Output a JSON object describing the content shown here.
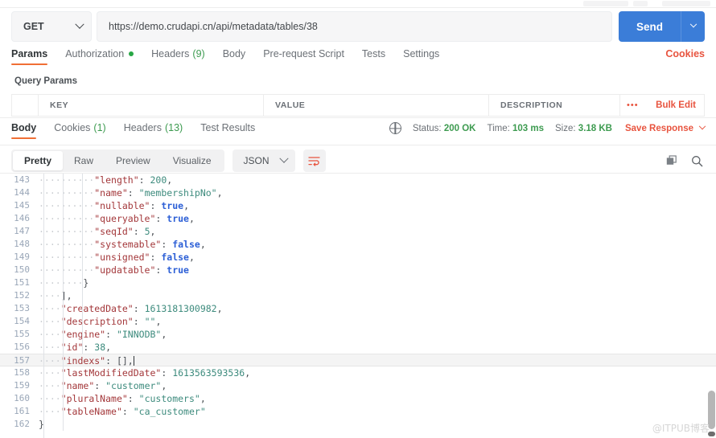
{
  "request": {
    "method": "GET",
    "url": "https://demo.crudapi.cn/api/metadata/tables/38",
    "send_label": "Send",
    "tabs": [
      {
        "label": "Params",
        "active": true,
        "marker": ""
      },
      {
        "label": "Authorization",
        "active": false,
        "marker": "dot"
      },
      {
        "label": "Headers",
        "active": false,
        "count": "(9)"
      },
      {
        "label": "Body",
        "active": false,
        "marker": ""
      },
      {
        "label": "Pre-request Script",
        "active": false,
        "marker": ""
      },
      {
        "label": "Tests",
        "active": false,
        "marker": ""
      },
      {
        "label": "Settings",
        "active": false,
        "marker": ""
      }
    ],
    "cookies_link": "Cookies"
  },
  "query_params": {
    "section_label": "Query Params",
    "columns": [
      "KEY",
      "VALUE",
      "DESCRIPTION"
    ],
    "bulk_edit_label": "Bulk Edit",
    "more_label": "•••"
  },
  "response": {
    "tabs": [
      {
        "label": "Body",
        "active": true,
        "count": ""
      },
      {
        "label": "Cookies",
        "active": false,
        "count": "(1)"
      },
      {
        "label": "Headers",
        "active": false,
        "count": "(13)"
      },
      {
        "label": "Test Results",
        "active": false,
        "count": ""
      }
    ],
    "status_label": "Status:",
    "status_value": "200 OK",
    "time_label": "Time:",
    "time_value": "103 ms",
    "size_label": "Size:",
    "size_value": "3.18 KB",
    "save_response_label": "Save Response",
    "format_tabs": [
      {
        "label": "Pretty",
        "active": true
      },
      {
        "label": "Raw",
        "active": false
      },
      {
        "label": "Preview",
        "active": false
      },
      {
        "label": "Visualize",
        "active": false
      }
    ],
    "language": "JSON"
  },
  "colors": {
    "accent_orange": "#f06f35",
    "link_orange": "#e8543f",
    "send_blue": "#3b7dd8",
    "status_green": "#3d9b50",
    "json_key": "#a3373a",
    "json_string": "#3d8b7d",
    "json_bool": "#2c5fd6"
  },
  "code": {
    "lines": [
      {
        "num": "143",
        "indent": 5,
        "tokens": [
          {
            "t": "k",
            "v": "\"length\""
          },
          {
            "t": "p",
            "v": ": "
          },
          {
            "t": "n",
            "v": "200"
          },
          {
            "t": "p",
            "v": ","
          }
        ]
      },
      {
        "num": "144",
        "indent": 5,
        "tokens": [
          {
            "t": "k",
            "v": "\"name\""
          },
          {
            "t": "p",
            "v": ": "
          },
          {
            "t": "s",
            "v": "\"membershipNo\""
          },
          {
            "t": "p",
            "v": ","
          }
        ]
      },
      {
        "num": "145",
        "indent": 5,
        "tokens": [
          {
            "t": "k",
            "v": "\"nullable\""
          },
          {
            "t": "p",
            "v": ": "
          },
          {
            "t": "b",
            "v": "true"
          },
          {
            "t": "p",
            "v": ","
          }
        ]
      },
      {
        "num": "146",
        "indent": 5,
        "tokens": [
          {
            "t": "k",
            "v": "\"queryable\""
          },
          {
            "t": "p",
            "v": ": "
          },
          {
            "t": "b",
            "v": "true"
          },
          {
            "t": "p",
            "v": ","
          }
        ]
      },
      {
        "num": "147",
        "indent": 5,
        "tokens": [
          {
            "t": "k",
            "v": "\"seqId\""
          },
          {
            "t": "p",
            "v": ": "
          },
          {
            "t": "n",
            "v": "5"
          },
          {
            "t": "p",
            "v": ","
          }
        ]
      },
      {
        "num": "148",
        "indent": 5,
        "tokens": [
          {
            "t": "k",
            "v": "\"systemable\""
          },
          {
            "t": "p",
            "v": ": "
          },
          {
            "t": "b",
            "v": "false"
          },
          {
            "t": "p",
            "v": ","
          }
        ]
      },
      {
        "num": "149",
        "indent": 5,
        "tokens": [
          {
            "t": "k",
            "v": "\"unsigned\""
          },
          {
            "t": "p",
            "v": ": "
          },
          {
            "t": "b",
            "v": "false"
          },
          {
            "t": "p",
            "v": ","
          }
        ]
      },
      {
        "num": "150",
        "indent": 5,
        "tokens": [
          {
            "t": "k",
            "v": "\"updatable\""
          },
          {
            "t": "p",
            "v": ": "
          },
          {
            "t": "b",
            "v": "true"
          }
        ]
      },
      {
        "num": "151",
        "indent": 4,
        "tokens": [
          {
            "t": "p",
            "v": "}"
          }
        ]
      },
      {
        "num": "152",
        "indent": 2,
        "tokens": [
          {
            "t": "p",
            "v": "],"
          }
        ]
      },
      {
        "num": "153",
        "indent": 2,
        "tokens": [
          {
            "t": "k",
            "v": "\"createdDate\""
          },
          {
            "t": "p",
            "v": ": "
          },
          {
            "t": "n",
            "v": "1613181300982"
          },
          {
            "t": "p",
            "v": ","
          }
        ]
      },
      {
        "num": "154",
        "indent": 2,
        "tokens": [
          {
            "t": "k",
            "v": "\"description\""
          },
          {
            "t": "p",
            "v": ": "
          },
          {
            "t": "s",
            "v": "\"\""
          },
          {
            "t": "p",
            "v": ","
          }
        ]
      },
      {
        "num": "155",
        "indent": 2,
        "tokens": [
          {
            "t": "k",
            "v": "\"engine\""
          },
          {
            "t": "p",
            "v": ": "
          },
          {
            "t": "s",
            "v": "\"INNODB\""
          },
          {
            "t": "p",
            "v": ","
          }
        ]
      },
      {
        "num": "156",
        "indent": 2,
        "tokens": [
          {
            "t": "k",
            "v": "\"id\""
          },
          {
            "t": "p",
            "v": ": "
          },
          {
            "t": "n",
            "v": "38"
          },
          {
            "t": "p",
            "v": ","
          }
        ]
      },
      {
        "num": "157",
        "indent": 2,
        "active": true,
        "caret": true,
        "tokens": [
          {
            "t": "k",
            "v": "\"indexs\""
          },
          {
            "t": "p",
            "v": ": "
          },
          {
            "t": "p",
            "v": "[],"
          }
        ]
      },
      {
        "num": "158",
        "indent": 2,
        "tokens": [
          {
            "t": "k",
            "v": "\"lastModifiedDate\""
          },
          {
            "t": "p",
            "v": ": "
          },
          {
            "t": "n",
            "v": "1613563593536"
          },
          {
            "t": "p",
            "v": ","
          }
        ]
      },
      {
        "num": "159",
        "indent": 2,
        "tokens": [
          {
            "t": "k",
            "v": "\"name\""
          },
          {
            "t": "p",
            "v": ": "
          },
          {
            "t": "s",
            "v": "\"customer\""
          },
          {
            "t": "p",
            "v": ","
          }
        ]
      },
      {
        "num": "160",
        "indent": 2,
        "tokens": [
          {
            "t": "k",
            "v": "\"pluralName\""
          },
          {
            "t": "p",
            "v": ": "
          },
          {
            "t": "s",
            "v": "\"customers\""
          },
          {
            "t": "p",
            "v": ","
          }
        ]
      },
      {
        "num": "161",
        "indent": 2,
        "tokens": [
          {
            "t": "k",
            "v": "\"tableName\""
          },
          {
            "t": "p",
            "v": ": "
          },
          {
            "t": "s",
            "v": "\"ca_customer\""
          }
        ]
      },
      {
        "num": "162",
        "indent": 0,
        "tokens": [
          {
            "t": "p",
            "v": "}"
          }
        ]
      }
    ]
  },
  "watermark": "@ITPUB博客"
}
